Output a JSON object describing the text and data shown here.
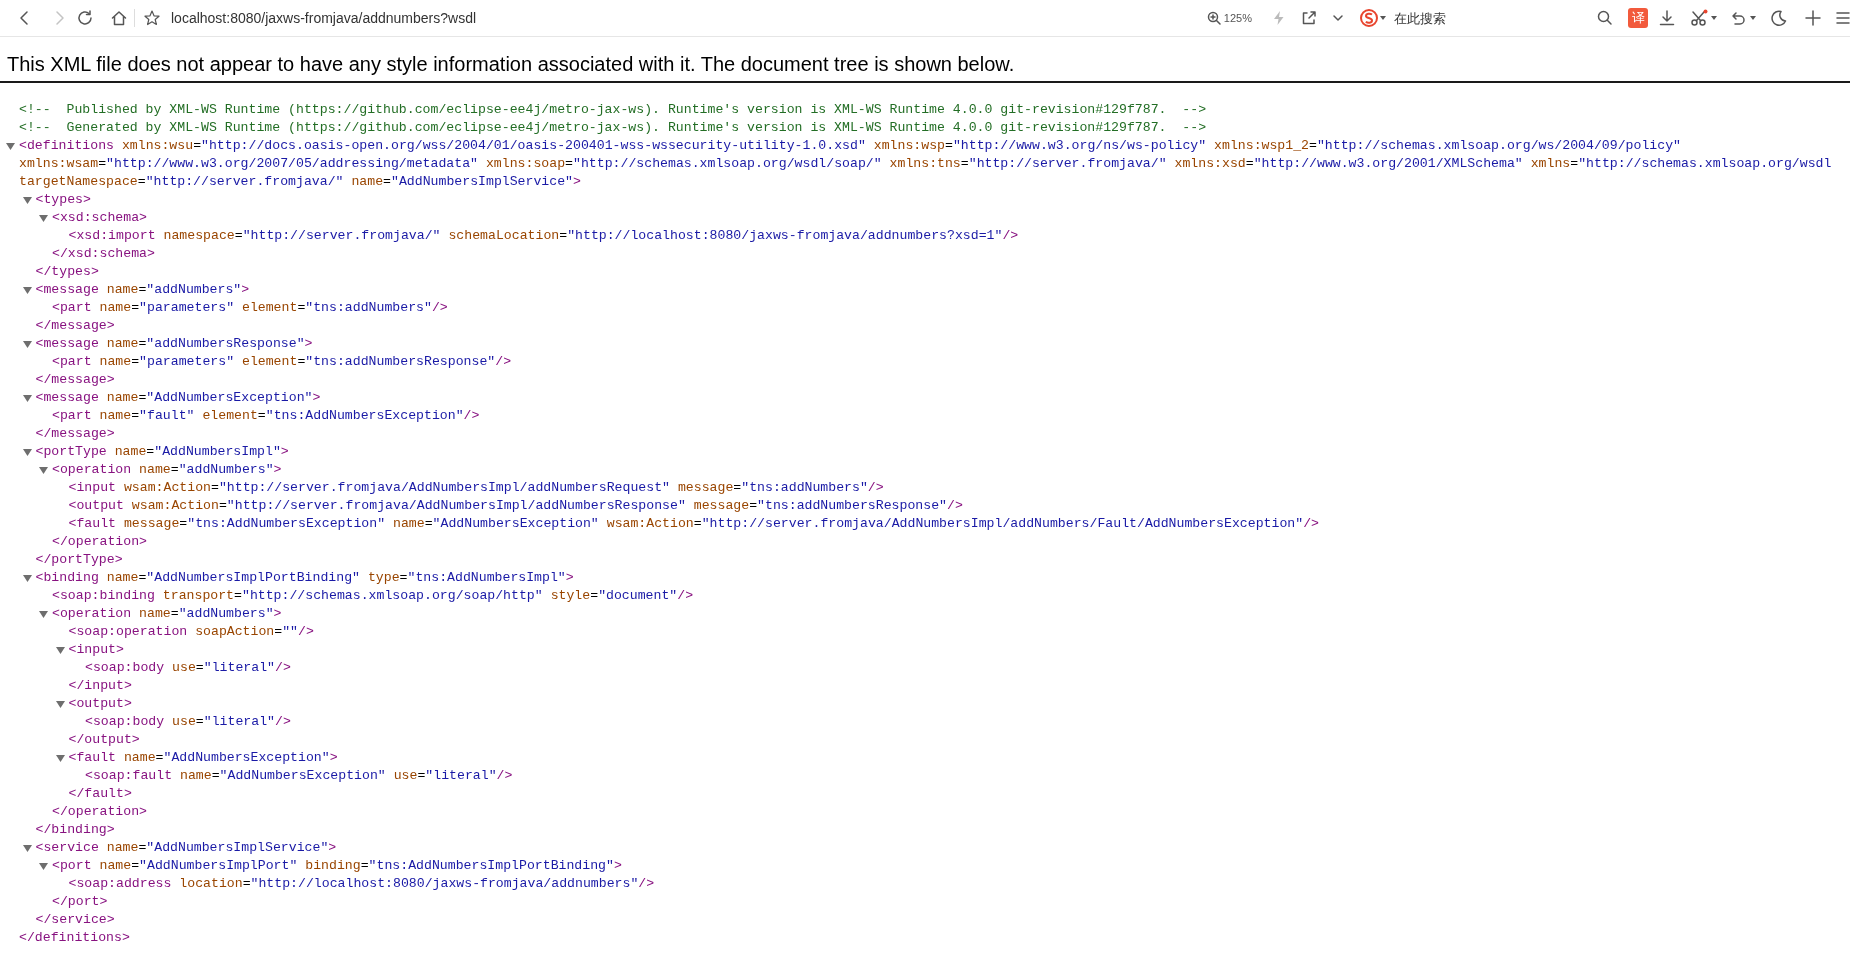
{
  "toolbar": {
    "back": {
      "disabled": false
    },
    "forward": {
      "disabled": true
    },
    "address": "localhost:8080/jaxws-fromjava/addnumbers?wsdl",
    "zoom": "125%",
    "search": {
      "placeholder": "在此搜索"
    },
    "translate": "译"
  },
  "notice": "This XML file does not appear to have any style information associated with it. The document tree is shown below.",
  "xml": [
    {
      "kind": "comment",
      "text": "<!--  Published by XML-WS Runtime (https://github.com/eclipse-ee4j/metro-jax-ws). Runtime's version is XML-WS Runtime 4.0.0 git-revision#129f787.  -->"
    },
    {
      "kind": "comment",
      "text": "<!--  Generated by XML-WS Runtime (https://github.com/eclipse-ee4j/metro-jax-ws). Runtime's version is XML-WS Runtime 4.0.0 git-revision#129f787.  -->"
    },
    {
      "kind": "element",
      "expanded": true,
      "open": [
        "<definitions xmlns:wsu=\"http://docs.oasis-open.org/wss/2004/01/oasis-200401-wss-wssecurity-utility-1.0.xsd\" xmlns:wsp=\"http://www.w3.org/ns/ws-policy\" xmlns:wsp1_2=\"http://schemas.xmlsoap.org/ws/2004/09/policy\"",
        "xmlns:wsam=\"http://www.w3.org/2007/05/addressing/metadata\" xmlns:soap=\"http://schemas.xmlsoap.org/wsdl/soap/\" xmlns:tns=\"http://server.fromjava/\" xmlns:xsd=\"http://www.w3.org/2001/XMLSchema\" xmlns=\"http://schemas.xmlsoap.org/wsdl",
        "targetNamespace=\"http://server.fromjava/\" name=\"AddNumbersImplService\">"
      ],
      "close": "</definitions>",
      "children": [
        {
          "kind": "element",
          "expanded": true,
          "open": "<types>",
          "close": "</types>",
          "children": [
            {
              "kind": "element",
              "expanded": true,
              "open": "<xsd:schema>",
              "close": "</xsd:schema>",
              "children": [
                {
                  "kind": "empty",
                  "open": "<xsd:import namespace=\"http://server.fromjava/\" schemaLocation=\"http://localhost:8080/jaxws-fromjava/addnumbers?xsd=1\"/>"
                }
              ]
            }
          ]
        },
        {
          "kind": "element",
          "expanded": true,
          "open": "<message name=\"addNumbers\">",
          "close": "</message>",
          "children": [
            {
              "kind": "empty",
              "open": "<part name=\"parameters\" element=\"tns:addNumbers\"/>"
            }
          ]
        },
        {
          "kind": "element",
          "expanded": true,
          "open": "<message name=\"addNumbersResponse\">",
          "close": "</message>",
          "children": [
            {
              "kind": "empty",
              "open": "<part name=\"parameters\" element=\"tns:addNumbersResponse\"/>"
            }
          ]
        },
        {
          "kind": "element",
          "expanded": true,
          "open": "<message name=\"AddNumbersException\">",
          "close": "</message>",
          "children": [
            {
              "kind": "empty",
              "open": "<part name=\"fault\" element=\"tns:AddNumbersException\"/>"
            }
          ]
        },
        {
          "kind": "element",
          "expanded": true,
          "open": "<portType name=\"AddNumbersImpl\">",
          "close": "</portType>",
          "children": [
            {
              "kind": "element",
              "expanded": true,
              "open": "<operation name=\"addNumbers\">",
              "close": "</operation>",
              "children": [
                {
                  "kind": "empty",
                  "open": "<input wsam:Action=\"http://server.fromjava/AddNumbersImpl/addNumbersRequest\" message=\"tns:addNumbers\"/>"
                },
                {
                  "kind": "empty",
                  "open": "<output wsam:Action=\"http://server.fromjava/AddNumbersImpl/addNumbersResponse\" message=\"tns:addNumbersResponse\"/>"
                },
                {
                  "kind": "empty",
                  "open": "<fault message=\"tns:AddNumbersException\" name=\"AddNumbersException\" wsam:Action=\"http://server.fromjava/AddNumbersImpl/addNumbers/Fault/AddNumbersException\"/>"
                }
              ]
            }
          ]
        },
        {
          "kind": "element",
          "expanded": true,
          "open": "<binding name=\"AddNumbersImplPortBinding\" type=\"tns:AddNumbersImpl\">",
          "close": "</binding>",
          "children": [
            {
              "kind": "empty",
              "open": "<soap:binding transport=\"http://schemas.xmlsoap.org/soap/http\" style=\"document\"/>"
            },
            {
              "kind": "element",
              "expanded": true,
              "open": "<operation name=\"addNumbers\">",
              "close": "</operation>",
              "children": [
                {
                  "kind": "empty",
                  "open": "<soap:operation soapAction=\"\"/>"
                },
                {
                  "kind": "element",
                  "expanded": true,
                  "open": "<input>",
                  "close": "</input>",
                  "children": [
                    {
                      "kind": "empty",
                      "open": "<soap:body use=\"literal\"/>"
                    }
                  ]
                },
                {
                  "kind": "element",
                  "expanded": true,
                  "open": "<output>",
                  "close": "</output>",
                  "children": [
                    {
                      "kind": "empty",
                      "open": "<soap:body use=\"literal\"/>"
                    }
                  ]
                },
                {
                  "kind": "element",
                  "expanded": true,
                  "open": "<fault name=\"AddNumbersException\">",
                  "close": "</fault>",
                  "children": [
                    {
                      "kind": "empty",
                      "open": "<soap:fault name=\"AddNumbersException\" use=\"literal\"/>"
                    }
                  ]
                }
              ]
            }
          ]
        },
        {
          "kind": "element",
          "expanded": true,
          "open": "<service name=\"AddNumbersImplService\">",
          "close": "</service>",
          "children": [
            {
              "kind": "element",
              "expanded": true,
              "open": "<port name=\"AddNumbersImplPort\" binding=\"tns:AddNumbersImplPortBinding\">",
              "close": "</port>",
              "children": [
                {
                  "kind": "empty",
                  "open": "<soap:address location=\"http://localhost:8080/jaxws-fromjava/addnumbers\"/>"
                }
              ]
            }
          ]
        }
      ]
    }
  ]
}
